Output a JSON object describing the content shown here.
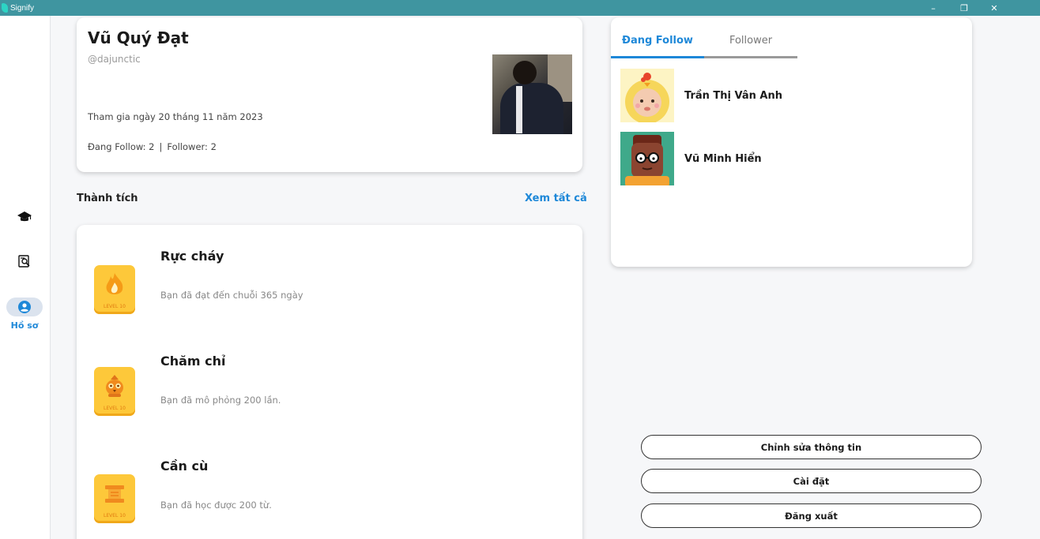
{
  "window": {
    "title": "Signify",
    "controls": [
      "–",
      "❐",
      "✕"
    ]
  },
  "sidebar": {
    "items": [
      {
        "icon": "graduation-cap-icon"
      },
      {
        "icon": "document-search-icon"
      },
      {
        "icon": "account-circle-icon",
        "label": "Hồ sơ",
        "active": true
      }
    ]
  },
  "profile": {
    "name": "Vũ Quý Đạt",
    "username": "@dajunctic",
    "joined": "Tham gia ngày 20 tháng 11 năm 2023",
    "following": "Đang Follow: 2",
    "separator": "|",
    "followers": "Follower: 2"
  },
  "achievements": {
    "title": "Thành tích",
    "see_all": "Xem tất cả",
    "items": [
      {
        "title": "Rực cháy",
        "desc": "Bạn đã đạt đến chuỗi 365 ngày",
        "badge_level": "LEVEL 10",
        "icon": "flame-icon"
      },
      {
        "title": "Chăm chỉ",
        "desc": "Bạn đã mô phỏng 200 lần.",
        "badge_level": "LEVEL 10",
        "icon": "owl-icon"
      },
      {
        "title": "Cần cù",
        "desc": "Bạn đã học được 200 từ.",
        "badge_level": "LEVEL 10",
        "icon": "dumbbell-icon"
      }
    ]
  },
  "follow_panel": {
    "tabs": [
      {
        "label": "Đang Follow",
        "active": true
      },
      {
        "label": "Follower",
        "active": false
      }
    ],
    "users": [
      {
        "name": "Trần Thị Vân Anh"
      },
      {
        "name": "Vũ Minh Hiển"
      }
    ]
  },
  "actions": {
    "edit": "Chỉnh sửa thông tin",
    "settings": "Cài đặt",
    "logout": "Đăng xuất"
  },
  "colors": {
    "accent": "#1e88d8",
    "titlebar": "#3f95a0",
    "badge": "#fdc83a"
  }
}
